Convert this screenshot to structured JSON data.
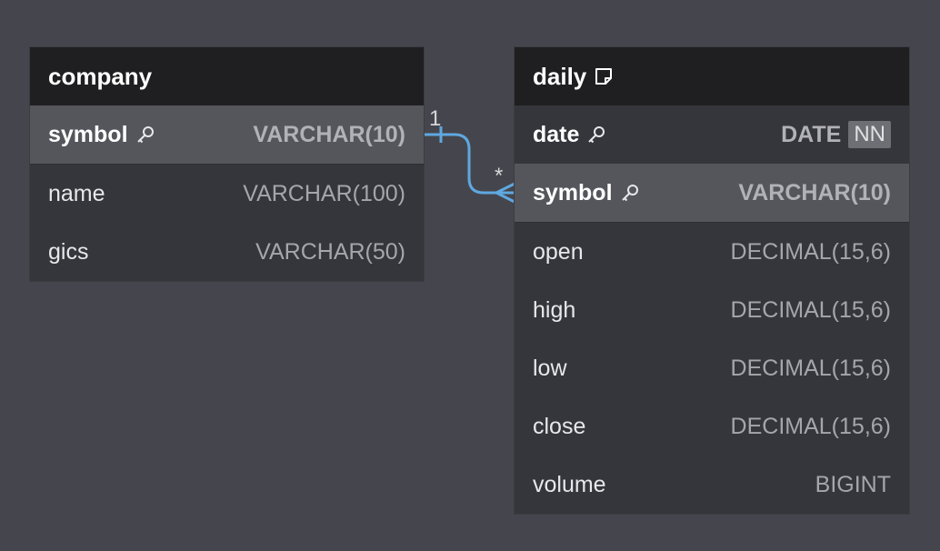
{
  "colors": {
    "canvas": "#45464d",
    "header": "#1f1f21",
    "relation_line": "#5fa8e0"
  },
  "tables": {
    "company": {
      "name": "company",
      "rows": [
        {
          "name": "symbol",
          "type": "VARCHAR(10)"
        },
        {
          "name": "name",
          "type": "VARCHAR(100)"
        },
        {
          "name": "gics",
          "type": "VARCHAR(50)"
        }
      ]
    },
    "daily": {
      "name": "daily",
      "rows": [
        {
          "name": "date",
          "type": "DATE",
          "badge": "NN"
        },
        {
          "name": "symbol",
          "type": "VARCHAR(10)"
        },
        {
          "name": "open",
          "type": "DECIMAL(15,6)"
        },
        {
          "name": "high",
          "type": "DECIMAL(15,6)"
        },
        {
          "name": "low",
          "type": "DECIMAL(15,6)"
        },
        {
          "name": "close",
          "type": "DECIMAL(15,6)"
        },
        {
          "name": "volume",
          "type": "BIGINT"
        }
      ]
    }
  },
  "relation": {
    "from_cardinality": "1",
    "to_cardinality": "*"
  }
}
